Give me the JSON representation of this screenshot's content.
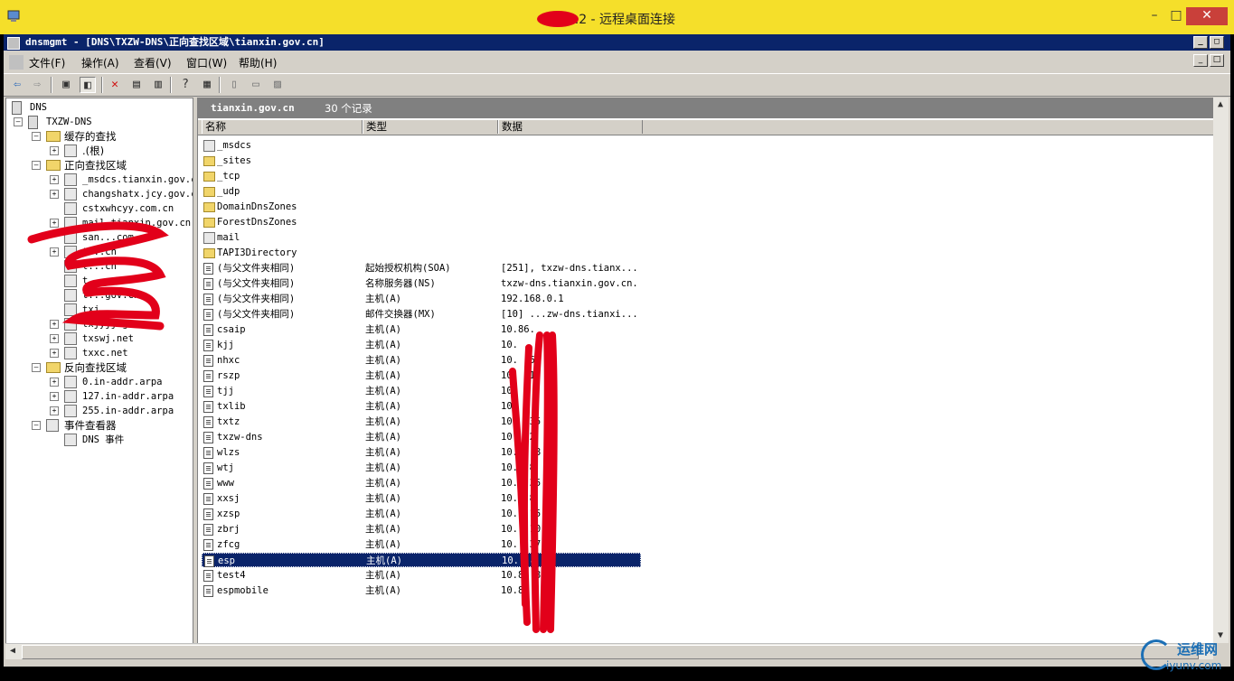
{
  "outer": {
    "title": "80.2 - 远程桌面连接",
    "minimize": "–",
    "maximize": "□",
    "close": "✕"
  },
  "app": {
    "title": "dnsmgmt - [DNS\\TXZW-DNS\\正向查找区域\\tianxin.gov.cn]",
    "menu": [
      "文件(F)",
      "操作(A)",
      "查看(V)",
      "窗口(W)",
      "帮助(H)"
    ]
  },
  "tree": {
    "root": "DNS",
    "server": "TXZW-DNS",
    "cache": "缓存的查找",
    "cache_root": ".(根)",
    "forward": "正向查找区域",
    "forward_zones": [
      "_msdcs.tianxin.gov.c",
      "changshatx.jcy.gov.c",
      "cstxwhcyy.com.cn",
      "mail.tianxin.gov.cn",
      "san...com",
      "t...cn",
      "t...cn",
      "t...",
      "t...gov.cn",
      "txj...",
      "txjyjj.gov.cn",
      "txswj.net",
      "txxc.net"
    ],
    "reverse": "反向查找区域",
    "reverse_zones": [
      "0.in-addr.arpa",
      "127.in-addr.arpa",
      "255.in-addr.arpa"
    ],
    "events": "事件查看器",
    "dns_events": "DNS 事件"
  },
  "panel": {
    "zone_name": "tianxin.gov.cn",
    "record_count": "30 个记录",
    "columns": [
      "名称",
      "类型",
      "数据"
    ]
  },
  "rows": [
    {
      "name": "_msdcs",
      "type": "",
      "data": "",
      "icon": "zone-icon"
    },
    {
      "name": "_sites",
      "type": "",
      "data": "",
      "icon": "folder-icon"
    },
    {
      "name": "_tcp",
      "type": "",
      "data": "",
      "icon": "folder-icon"
    },
    {
      "name": "_udp",
      "type": "",
      "data": "",
      "icon": "folder-icon"
    },
    {
      "name": "DomainDnsZones",
      "type": "",
      "data": "",
      "icon": "folder-icon"
    },
    {
      "name": "ForestDnsZones",
      "type": "",
      "data": "",
      "icon": "folder-icon"
    },
    {
      "name": "mail",
      "type": "",
      "data": "",
      "icon": "zone-icon"
    },
    {
      "name": "TAPI3Directory",
      "type": "",
      "data": "",
      "icon": "folder-icon"
    },
    {
      "name": "(与父文件夹相同)",
      "type": "起始授权机构(SOA)",
      "data": "[251], txzw-dns.tianx...",
      "icon": "record-icon"
    },
    {
      "name": "(与父文件夹相同)",
      "type": "名称服务器(NS)",
      "data": "txzw-dns.tianxin.gov.cn.",
      "icon": "record-icon"
    },
    {
      "name": "(与父文件夹相同)",
      "type": "主机(A)",
      "data": "192.168.0.1",
      "icon": "record-icon"
    },
    {
      "name": "(与父文件夹相同)",
      "type": "邮件交换器(MX)",
      "data": "[10] ...zw-dns.tianxi...",
      "icon": "record-icon"
    },
    {
      "name": "csaip",
      "type": "主机(A)",
      "data": "10.86.",
      "icon": "record-icon"
    },
    {
      "name": "kjj",
      "type": "主机(A)",
      "data": "10.",
      "icon": "record-icon"
    },
    {
      "name": "nhxc",
      "type": "主机(A)",
      "data": "10.    .5",
      "icon": "record-icon"
    },
    {
      "name": "rszp",
      "type": "主机(A)",
      "data": "10.    .1",
      "icon": "record-icon"
    },
    {
      "name": "tjj",
      "type": "主机(A)",
      "data": "10.",
      "icon": "record-icon"
    },
    {
      "name": "txlib",
      "type": "主机(A)",
      "data": "10.",
      "icon": "record-icon"
    },
    {
      "name": "txtz",
      "type": "主机(A)",
      "data": "10.    .35",
      "icon": "record-icon"
    },
    {
      "name": "txzw-dns",
      "type": "主机(A)",
      "data": "10.    .2",
      "icon": "record-icon"
    },
    {
      "name": "wlzs",
      "type": "主机(A)",
      "data": "10.8    .8",
      "icon": "record-icon"
    },
    {
      "name": "wtj",
      "type": "主机(A)",
      "data": "10.    .8",
      "icon": "record-icon"
    },
    {
      "name": "www",
      "type": "主机(A)",
      "data": "10.    .35",
      "icon": "record-icon"
    },
    {
      "name": "xxsj",
      "type": "主机(A)",
      "data": "10.    .8",
      "icon": "record-icon"
    },
    {
      "name": "xzsp",
      "type": "主机(A)",
      "data": "10.    .15",
      "icon": "record-icon"
    },
    {
      "name": "zbrj",
      "type": "主机(A)",
      "data": "10.    .10",
      "icon": "record-icon"
    },
    {
      "name": "zfcg",
      "type": "主机(A)",
      "data": "10.    .37",
      "icon": "record-icon"
    },
    {
      "name": "esp",
      "type": "主机(A)",
      "data": "10.    .8",
      "icon": "record-icon",
      "selected": true
    },
    {
      "name": "test4",
      "type": "主机(A)",
      "data": "10.8    .8",
      "icon": "record-icon"
    },
    {
      "name": "espmobile",
      "type": "主机(A)",
      "data": "10.86    .8",
      "icon": "record-icon"
    }
  ],
  "watermark": {
    "brand": "运维网",
    "url": "iyunv.com"
  },
  "colors": {
    "titlebar": "#0a246a",
    "outer_titlebar": "#f5df2a",
    "redaction": "#e2001a",
    "selection": "#0a246a"
  }
}
